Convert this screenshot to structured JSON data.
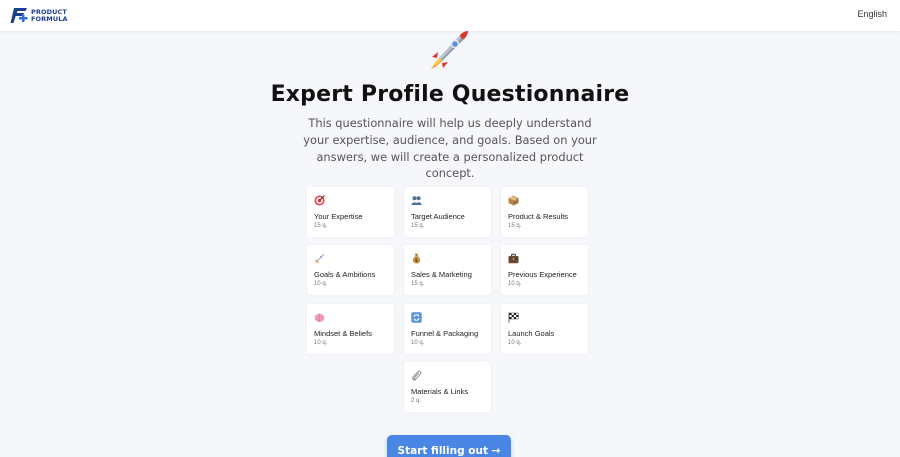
{
  "header": {
    "logo_line1": "PRODUCT",
    "logo_line2": "FORMULA",
    "language": "English"
  },
  "hero": {
    "icon": "rocket-icon",
    "title": "Expert Profile Questionnaire",
    "subtitle": "This questionnaire will help us deeply understand your expertise, audience, and goals. Based on your answers, we will create a personalized product concept."
  },
  "sections": [
    {
      "icon": "target-icon",
      "title": "Your Expertise",
      "count": "15 q."
    },
    {
      "icon": "people-icon",
      "title": "Target Audience",
      "count": "15 q."
    },
    {
      "icon": "package-icon",
      "title": "Product & Results",
      "count": "15 q."
    },
    {
      "icon": "rocket-icon",
      "title": "Goals & Ambitions",
      "count": "10 q."
    },
    {
      "icon": "money-bag-icon",
      "title": "Sales & Marketing",
      "count": "15 q."
    },
    {
      "icon": "briefcase-icon",
      "title": "Previous Experience",
      "count": "10 q."
    },
    {
      "icon": "brain-icon",
      "title": "Mindset & Beliefs",
      "count": "10 q."
    },
    {
      "icon": "cycle-icon",
      "title": "Funnel & Packaging",
      "count": "10 q."
    },
    {
      "icon": "checkered-flag-icon",
      "title": "Launch Goals",
      "count": "10 q."
    },
    {
      "icon": "paperclip-icon",
      "title": "Materials & Links",
      "count": "2 q."
    }
  ],
  "cta": {
    "label": "Start filling out →"
  },
  "colors": {
    "accent": "#4a86e4",
    "brand": "#1d3f8f",
    "background": "#f5f7fa"
  }
}
